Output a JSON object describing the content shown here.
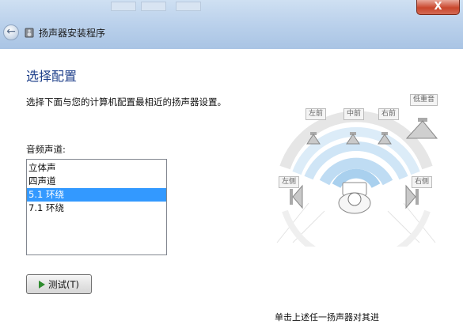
{
  "window": {
    "title": "扬声器安装程序",
    "close_glyph": "X"
  },
  "page": {
    "heading": "选择配置",
    "instruction": "选择下面与您的计算机配置最相近的扬声器设置。",
    "list_label": "音频声道:",
    "channels": [
      "立体声",
      "四声道",
      "5.1 环绕",
      "7.1 环绕"
    ],
    "selected_channel": "5.1 环绕",
    "test_button": "测试(T)",
    "footer_text": "单击上述任一扬声器对其进"
  },
  "speakers": {
    "front_left": "左前",
    "center": "中前",
    "front_right": "右前",
    "subwoofer": "低重音",
    "side_left": "左侧",
    "side_right": "右侧"
  }
}
